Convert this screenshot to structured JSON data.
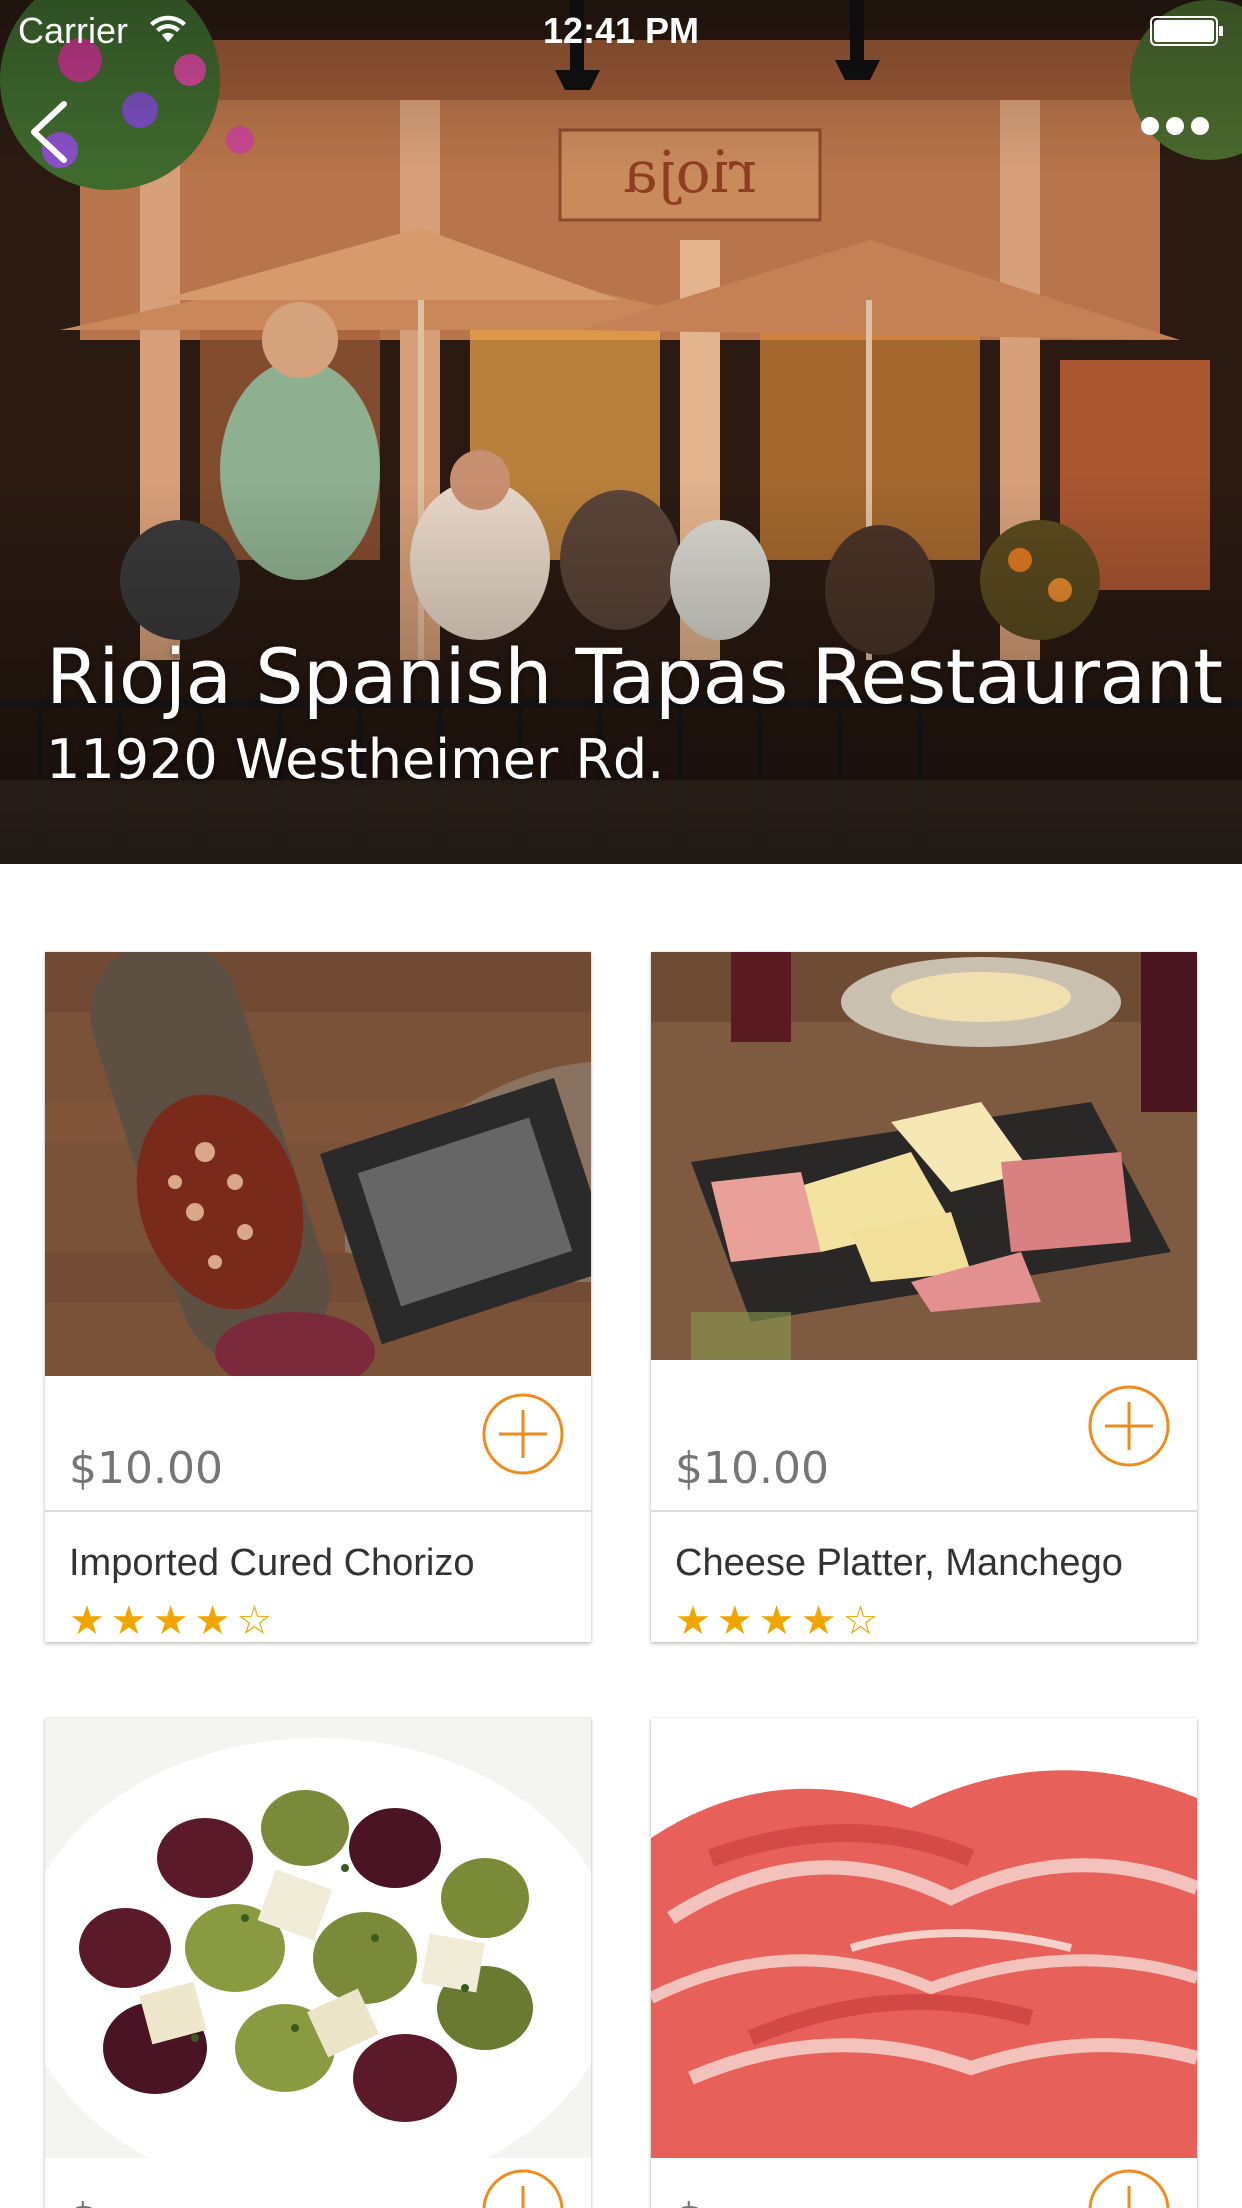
{
  "status_bar": {
    "carrier": "Carrier",
    "time": "12:41 PM"
  },
  "header": {
    "back_icon": "chevron-left-icon",
    "more_icon": "ellipsis-icon",
    "sign_text": "rioja"
  },
  "restaurant": {
    "name": "Rioja Spanish Tapas Restaurant",
    "address": "11920 Westheimer Rd."
  },
  "colors": {
    "accent": "#f08a1c",
    "star": "#f0a500",
    "price_text": "#757575"
  },
  "items": [
    {
      "name": "Imported Cured Chorizo",
      "price": "$10.00",
      "rating": 4,
      "max_rating": 5,
      "stars": "★★★★",
      "empty_stars": "☆"
    },
    {
      "name": "Cheese Platter, Manchego",
      "price": "$10.00",
      "rating": 4,
      "max_rating": 5,
      "stars": "★★★★",
      "empty_stars": "☆"
    },
    {
      "name": "",
      "price": "$",
      "rating": null
    },
    {
      "name": "",
      "price": "$",
      "rating": null
    }
  ]
}
